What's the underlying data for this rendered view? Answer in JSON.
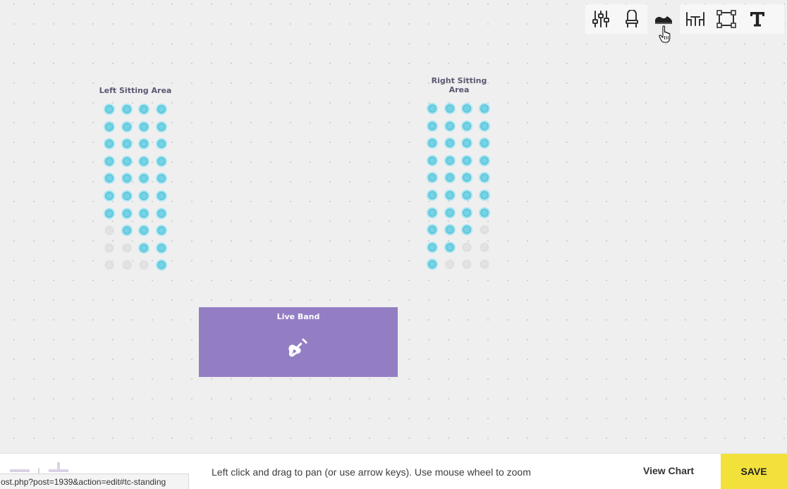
{
  "toolbar": {
    "tools": [
      {
        "name": "settings-sliders-icon"
      },
      {
        "name": "chair-icon"
      },
      {
        "name": "standing-shoe-icon"
      },
      {
        "name": "table-icon"
      },
      {
        "name": "rectangle-select-icon"
      },
      {
        "name": "text-icon"
      }
    ],
    "active_tool": "standing-shoe-icon"
  },
  "areas": [
    {
      "title": "Left Sitting Area",
      "rows": [
        [
          1,
          1,
          1,
          1
        ],
        [
          1,
          1,
          1,
          1
        ],
        [
          1,
          1,
          1,
          1
        ],
        [
          1,
          1,
          1,
          1
        ],
        [
          1,
          1,
          1,
          1
        ],
        [
          1,
          1,
          1,
          1
        ],
        [
          1,
          1,
          1,
          1
        ],
        [
          0,
          1,
          1,
          1
        ],
        [
          0,
          0,
          1,
          1
        ],
        [
          0,
          0,
          0,
          1
        ]
      ]
    },
    {
      "title": "Right Sitting Area",
      "rows": [
        [
          1,
          1,
          1,
          1
        ],
        [
          1,
          1,
          1,
          1
        ],
        [
          1,
          1,
          1,
          1
        ],
        [
          1,
          1,
          1,
          1
        ],
        [
          1,
          1,
          1,
          1
        ],
        [
          1,
          1,
          1,
          1
        ],
        [
          1,
          1,
          1,
          1
        ],
        [
          1,
          1,
          1,
          0
        ],
        [
          1,
          1,
          0,
          0
        ],
        [
          1,
          0,
          0,
          0
        ]
      ]
    }
  ],
  "stage": {
    "title": "Live Band",
    "icon": "guitar-icon",
    "color": "#937ec4"
  },
  "bottom": {
    "hint": "Left click and drag to pan (or use arrow keys). Use mouse wheel to zoom",
    "view_chart": "View Chart",
    "save": "SAVE",
    "status_url": "ost.php?post=1939&action=edit#tc-standing"
  },
  "colors": {
    "seat_available": "#75d3e5",
    "seat_unavailable": "#e2e2e2",
    "save_button": "#f3e13b",
    "area_title": "#5b5873"
  }
}
